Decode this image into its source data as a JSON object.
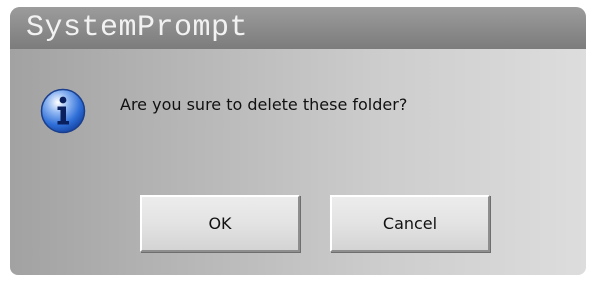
{
  "dialog": {
    "title": "SystemPrompt",
    "message": "Are you sure to delete these folder?",
    "icon": "info-icon",
    "buttons": {
      "ok_label": "OK",
      "cancel_label": "Cancel"
    }
  },
  "colors": {
    "titlebar": "#8a8a8a",
    "title_text": "#f2f2f2",
    "icon_blue": "#1f5fd0"
  }
}
